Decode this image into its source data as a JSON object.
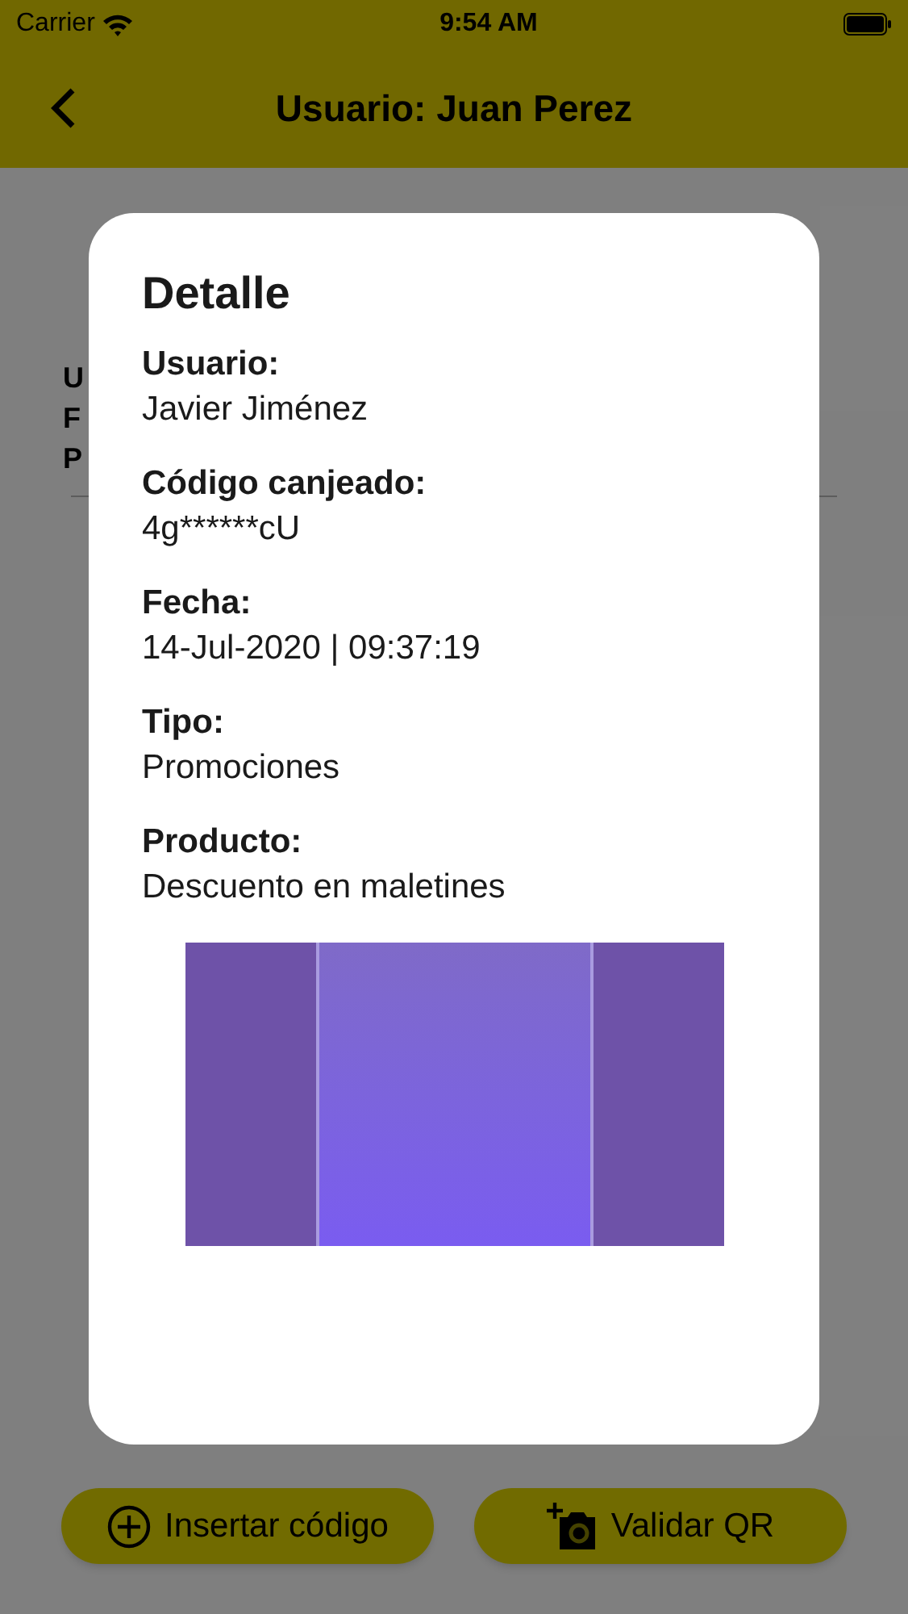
{
  "status_bar": {
    "carrier": "Carrier",
    "time": "9:54 AM"
  },
  "nav_bar": {
    "title": "Usuario: Juan Perez"
  },
  "background_labels": [
    "U",
    "F",
    "P"
  ],
  "actions": [
    {
      "kind": "insert",
      "label": "Insertar código"
    },
    {
      "kind": "qr",
      "label": "Validar QR"
    }
  ],
  "dialog": {
    "title": "Detalle",
    "fields": [
      {
        "label": "Usuario:",
        "value": "Javier Jiménez"
      },
      {
        "label": "Código canjeado:",
        "value": "4g******cU"
      },
      {
        "label": "Fecha:",
        "value": "14-Jul-2020 | 09:37:19"
      },
      {
        "label": "Tipo:",
        "value": "Promociones"
      },
      {
        "label": "Producto:",
        "value": "Descuento en maletines"
      }
    ]
  }
}
